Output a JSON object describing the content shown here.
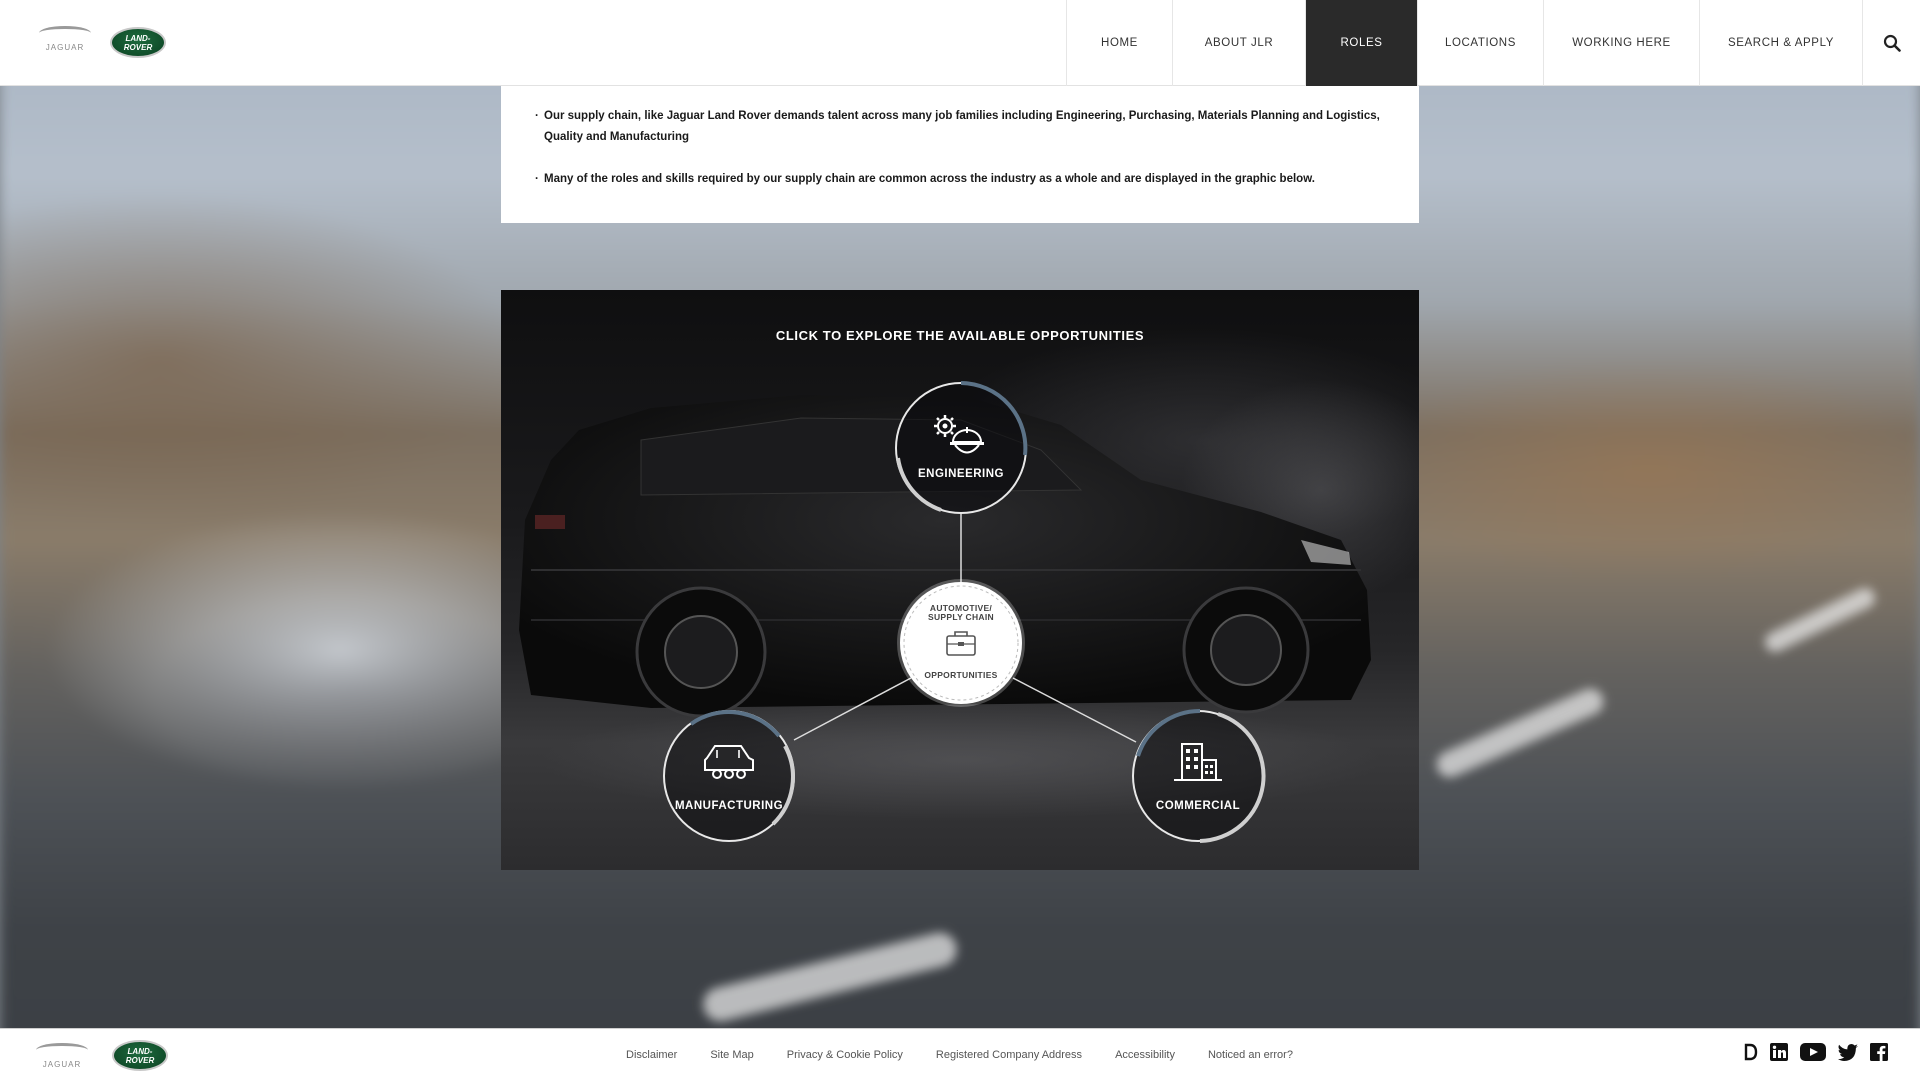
{
  "header": {
    "logos": {
      "jaguar_text": "JAGUAR",
      "land_rover_text": "LAND-\nROVER"
    },
    "nav": [
      {
        "label": "HOME",
        "active": false
      },
      {
        "label": "ABOUT JLR",
        "active": false
      },
      {
        "label": "ROLES",
        "active": true
      },
      {
        "label": "LOCATIONS",
        "active": false
      },
      {
        "label": "WORKING HERE",
        "active": false
      },
      {
        "label": "SEARCH & APPLY",
        "active": false
      }
    ],
    "search_icon": "search-icon"
  },
  "intro": {
    "bullets": [
      "Our supply chain, like Jaguar Land Rover demands talent across many job families including Engineering, Purchasing, Materials Planning and Logistics, Quality and Manufacturing",
      "Many of the roles and skills required by our supply chain are common across the industry as a whole and are displayed in the graphic below."
    ]
  },
  "graphic": {
    "title": "CLICK TO EXPLORE THE AVAILABLE OPPORTUNITIES",
    "center": {
      "top": "AUTOMOTIVE/\nSUPPLY CHAIN",
      "bottom": "OPPORTUNITIES",
      "icon": "briefcase-icon"
    },
    "nodes": [
      {
        "label": "ENGINEERING",
        "icon": "gear-hardhat-icon"
      },
      {
        "label": "MANUFACTURING",
        "icon": "car-icon"
      },
      {
        "label": "COMMERCIAL",
        "icon": "buildings-icon"
      }
    ],
    "colors": {
      "ring_accent": "#5b7287",
      "ring_light": "#d0d0d0"
    }
  },
  "footer": {
    "links": [
      "Disclaimer",
      "Site Map",
      "Privacy & Cookie Policy",
      "Registered Company Address",
      "Accessibility",
      "Noticed an error?"
    ],
    "social": [
      "d-icon",
      "linkedin-icon",
      "youtube-icon",
      "twitter-icon",
      "facebook-icon"
    ]
  }
}
